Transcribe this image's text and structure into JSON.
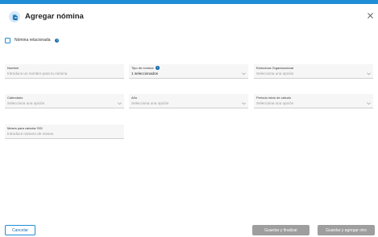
{
  "header": {
    "title": "Agregar nómina",
    "icon": "payroll-document-icon",
    "close_icon": "close-icon"
  },
  "colors": {
    "accent": "#1f8ed6",
    "disabled_button": "#9e9e9e"
  },
  "related": {
    "label": "Nómina relacionada",
    "checked": false
  },
  "fields": {
    "nombre": {
      "label": "Nombre",
      "placeholder": "Introduce un nombre para tu nómina"
    },
    "tipo": {
      "label": "Tipo de nómina",
      "value": "1 seleccionados"
    },
    "estructura": {
      "label": "Estructura Organizacional",
      "placeholder": "Selecciona una opción"
    },
    "calendario": {
      "label": "Calendario",
      "placeholder": "Selecciona una opción"
    },
    "anio": {
      "label": "Año",
      "placeholder": "Selecciona una opción"
    },
    "periodo": {
      "label": "Periodo inicio de cálculo",
      "placeholder": "Selecciona una opción"
    },
    "meses": {
      "label": "Meses para calcular SDI",
      "placeholder": "Introduce número de meses"
    }
  },
  "footer": {
    "cancel": "Cancelar",
    "save_finish": "Guardar y finalizar",
    "save_other": "Guardar y agregar otro"
  }
}
